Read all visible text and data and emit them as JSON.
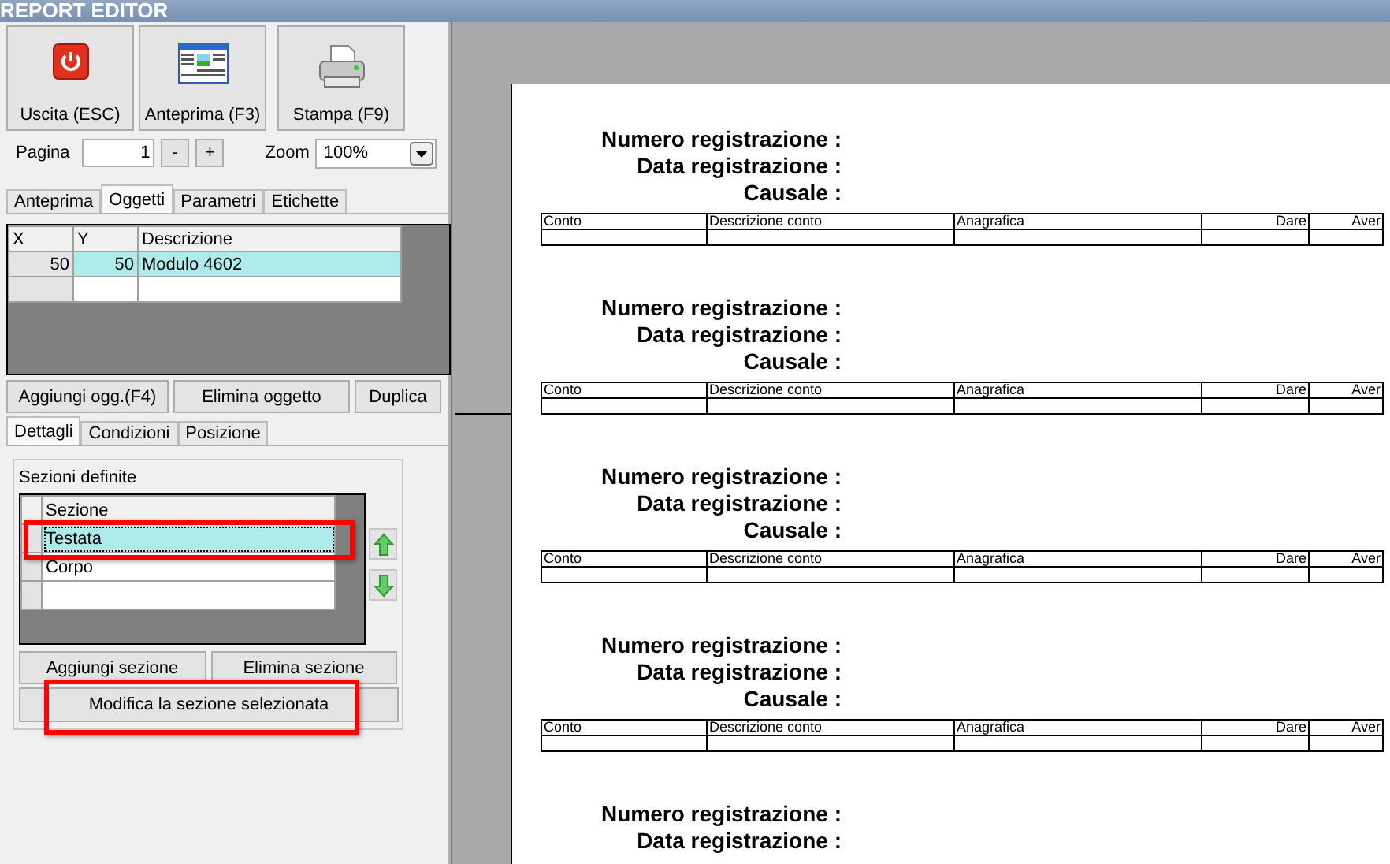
{
  "window": {
    "title": "REPORT EDITOR"
  },
  "toolbar": [
    {
      "label": "Uscita (ESC)",
      "kind": "exit"
    },
    {
      "label": "Anteprima (F3)",
      "kind": "preview"
    },
    {
      "label": "Stampa (F9)",
      "kind": "print"
    }
  ],
  "pager": {
    "label": "Pagina",
    "value": "1",
    "minus": "-",
    "plus": "+",
    "zoom_label": "Zoom",
    "zoom_value": "100%"
  },
  "tabs": [
    {
      "label": "Anteprima",
      "selected": false
    },
    {
      "label": "Oggetti",
      "selected": true
    },
    {
      "label": "Parametri",
      "selected": false
    },
    {
      "label": "Etichette",
      "selected": false
    }
  ],
  "objects_table": {
    "columns": [
      "X",
      "Y",
      "Descrizione"
    ],
    "rows": [
      {
        "cells": [
          "50",
          "50",
          "Modulo 4602"
        ],
        "selected": true
      }
    ]
  },
  "object_buttons": [
    "Aggiungi ogg.(F4)",
    "Elimina oggetto",
    "Duplica"
  ],
  "detail_tabs": [
    {
      "label": "Dettagli",
      "selected": true
    },
    {
      "label": "Condizioni",
      "selected": false
    },
    {
      "label": "Posizione",
      "selected": false
    }
  ],
  "sections": {
    "title": "Sezioni definite",
    "column": "Sezione",
    "highlighted": true,
    "rows": [
      {
        "label": "Testata",
        "selected": true
      },
      {
        "label": "Corpo",
        "selected": false
      }
    ],
    "buttons": [
      "Aggiungi sezione",
      "Elimina sezione"
    ],
    "edit_button": {
      "label": "Modifica la sezione selezionata",
      "highlighted": true
    }
  },
  "report_blocks": [
    {
      "fields": [
        "Numero registrazione :",
        "Data registrazione :",
        "Causale :"
      ],
      "columns": [
        "Conto",
        "Descrizione conto",
        "Anagrafica",
        "Dare",
        "Aver"
      ]
    },
    {
      "fields": [
        "Numero registrazione :",
        "Data registrazione :",
        "Causale :"
      ],
      "columns": [
        "Conto",
        "Descrizione conto",
        "Anagrafica",
        "Dare",
        "Aver"
      ]
    },
    {
      "fields": [
        "Numero registrazione :",
        "Data registrazione :",
        "Causale :"
      ],
      "columns": [
        "Conto",
        "Descrizione conto",
        "Anagrafica",
        "Dare",
        "Aver"
      ]
    },
    {
      "fields": [
        "Numero registrazione :",
        "Data registrazione :",
        "Causale :"
      ],
      "columns": [
        "Conto",
        "Descrizione conto",
        "Anagrafica",
        "Dare",
        "Aver"
      ]
    },
    {
      "fields": [
        "Numero registrazione :",
        "Data registrazione :"
      ]
    }
  ]
}
